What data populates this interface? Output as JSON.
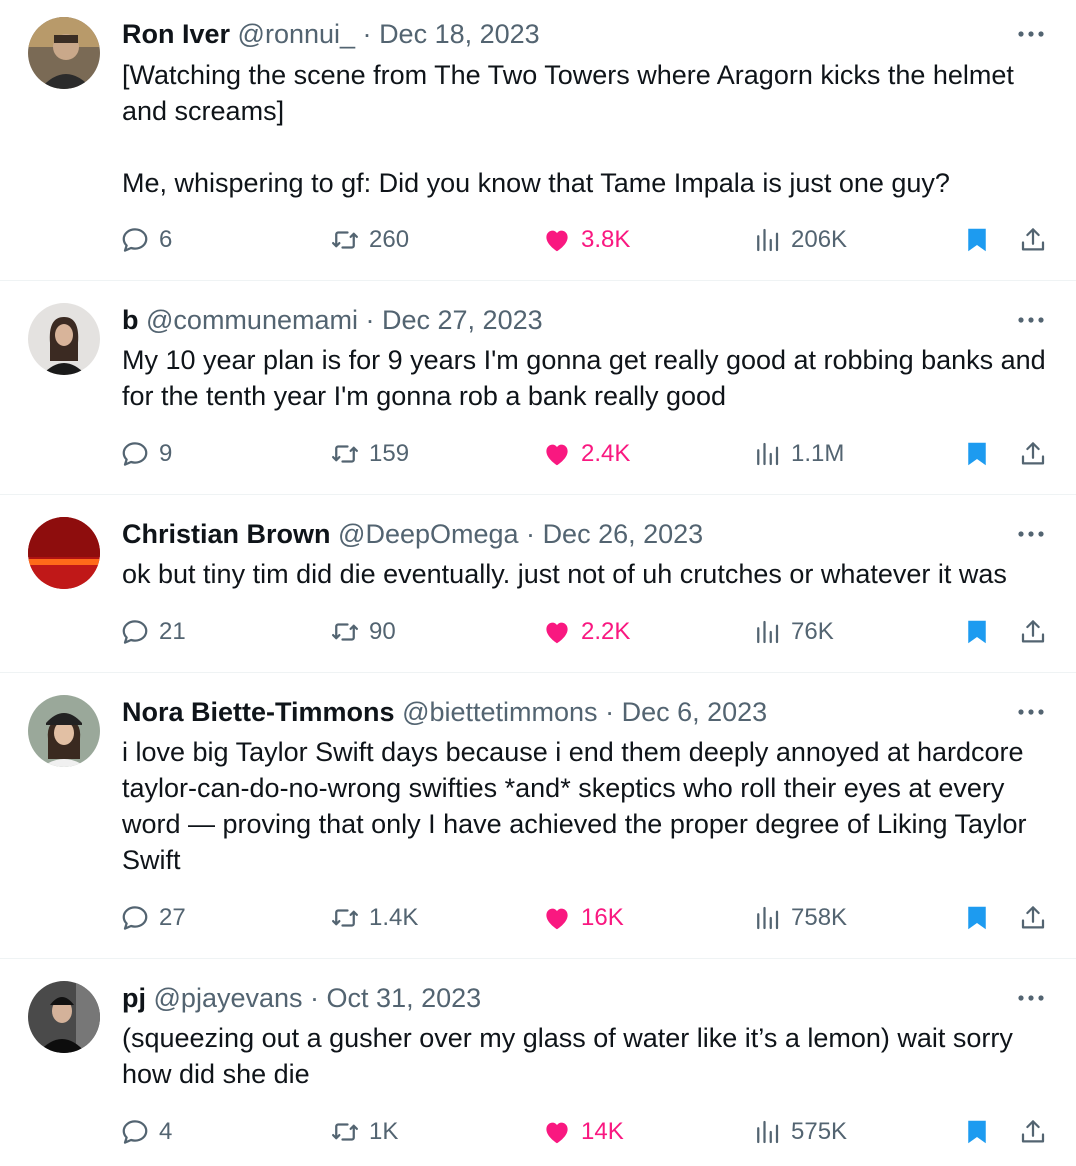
{
  "colors": {
    "like": "#f91880",
    "bookmark": "#1d9bf0",
    "muted": "#536471",
    "text": "#0f1419"
  },
  "icons": {
    "reply": "reply-icon",
    "retweet": "retweet-icon",
    "like": "heart-icon",
    "views": "views-icon",
    "bookmark": "bookmark-icon",
    "share": "share-icon",
    "more": "more-icon"
  },
  "tweets": [
    {
      "name": "Ron Iver",
      "handle": "@ronnui_",
      "sep": "·",
      "date": "Dec 18, 2023",
      "text": "[Watching the scene from The Two Towers where Aragorn kicks the helmet and screams]\n\nMe, whispering to gf: Did you know that Tame Impala is just one guy?",
      "replies": "6",
      "retweets": "260",
      "likes": "3.8K",
      "views": "206K"
    },
    {
      "name": "b",
      "handle": "@communemami",
      "sep": "·",
      "date": "Dec 27, 2023",
      "text": "My 10 year plan is for 9 years I'm gonna get really good at robbing banks and for the tenth year I'm gonna rob a bank really good",
      "replies": "9",
      "retweets": "159",
      "likes": "2.4K",
      "views": "1.1M"
    },
    {
      "name": "Christian Brown",
      "handle": "@DeepOmega",
      "sep": "·",
      "date": "Dec 26, 2023",
      "text": "ok but tiny tim did die eventually. just not of uh crutches or whatever it was",
      "replies": "21",
      "retweets": "90",
      "likes": "2.2K",
      "views": "76K"
    },
    {
      "name": "Nora Biette-Timmons",
      "handle": "@biettetimmons",
      "sep": "·",
      "date": "Dec 6, 2023",
      "text": "i love big Taylor Swift days because i end them deeply annoyed at hardcore taylor-can-do-no-wrong swifties *and* skeptics who roll their eyes at every word — proving that only I have achieved the proper degree of Liking Taylor Swift",
      "replies": "27",
      "retweets": "1.4K",
      "likes": "16K",
      "views": "758K"
    },
    {
      "name": "pj",
      "handle": "@pjayevans",
      "sep": "·",
      "date": "Oct 31, 2023",
      "text": "(squeezing out a gusher over my glass of water like it’s a lemon) wait sorry how did she die",
      "replies": "4",
      "retweets": "1K",
      "likes": "14K",
      "views": "575K"
    }
  ]
}
